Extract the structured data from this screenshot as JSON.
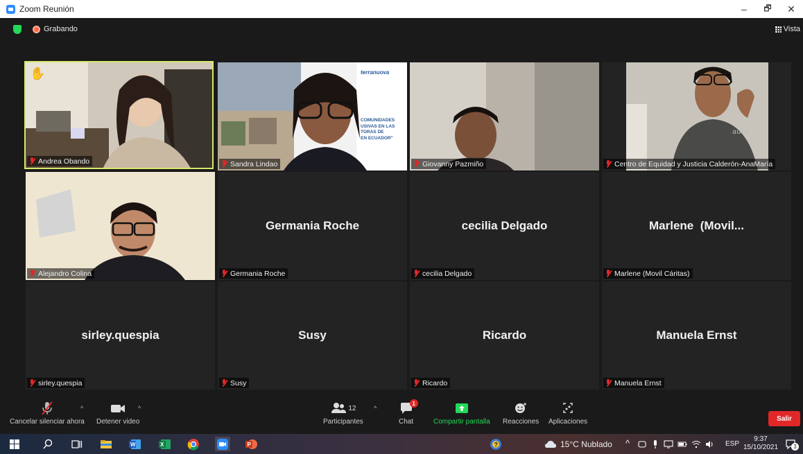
{
  "window": {
    "title": "Zoom Reunión",
    "minimize": "–",
    "maximize": "🗗",
    "close": "✕"
  },
  "meeting": {
    "recording_label": "Grabando",
    "view_label": "Vista",
    "participants": [
      {
        "name": "Andrea Obando",
        "display": "",
        "video": true,
        "active": true
      },
      {
        "name": "Sandra Lindao",
        "display": "",
        "video": true,
        "active": false
      },
      {
        "name": "Giovanny Pazmiño",
        "display": "",
        "video": true,
        "active": false
      },
      {
        "name": "Centro de Equidad y Justicia Calderón-AnaMaría",
        "display": "",
        "video": true,
        "active": false
      },
      {
        "name": "Alejandro Colina",
        "display": "",
        "video": true,
        "active": false
      },
      {
        "name": "Germania Roche",
        "display": "Germania Roche",
        "video": false,
        "active": false
      },
      {
        "name": "cecilia Delgado",
        "display": "cecilia Delgado",
        "video": false,
        "active": false
      },
      {
        "name": "Marlene (Movil Cáritas)",
        "display": "Marlene  (Movil...",
        "video": false,
        "active": false
      },
      {
        "name": "sirley.quespia",
        "display": "sirley.quespia",
        "video": false,
        "active": false
      },
      {
        "name": "Susy",
        "display": "Susy",
        "video": false,
        "active": false
      },
      {
        "name": "Ricardo",
        "display": "Ricardo",
        "video": false,
        "active": false
      },
      {
        "name": "Manuela Ernst",
        "display": "Manuela Ernst",
        "video": false,
        "active": false
      }
    ],
    "slide_text": {
      "brand": "terranuova",
      "line1": "COMUNIDADES",
      "line2": "USIVAS EN LAS",
      "line3": "TORAS DE",
      "line4": "EN ECUADOR\""
    },
    "jacket_text": "auno"
  },
  "toolbar": {
    "unmute_label": "Cancelar silenciar ahora",
    "video_label": "Detener video",
    "participants_label": "Participantes",
    "participants_count": "12",
    "chat_label": "Chat",
    "chat_badge": "1",
    "share_label": "Compartir pantalla",
    "reactions_label": "Reacciones",
    "apps_label": "Aplicaciones",
    "leave_label": "Salir"
  },
  "taskbar": {
    "weather": "15°C  Nublado",
    "language": "ESP",
    "time": "9:37",
    "date": "15/10/2021",
    "notif_count": "3"
  },
  "colors": {
    "active_border": "#d8e96a",
    "share_green": "#23d959",
    "leave_red": "#e02828",
    "tile_bg": "#232323"
  }
}
